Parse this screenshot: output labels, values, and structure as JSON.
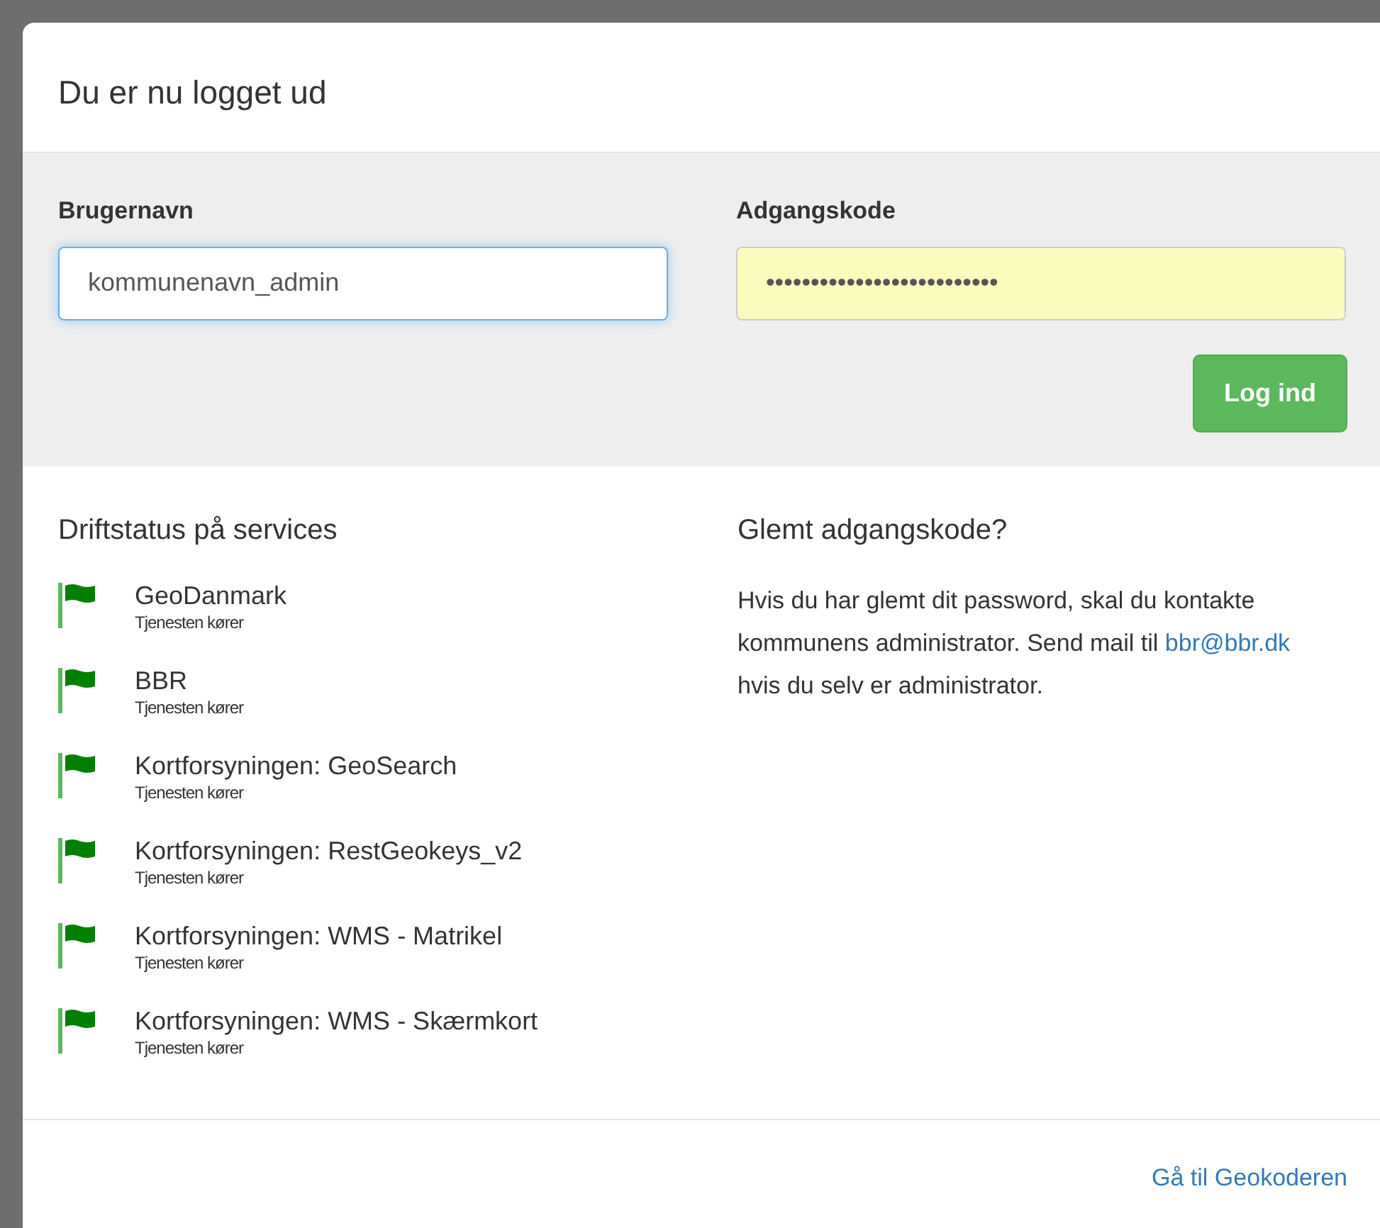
{
  "modal": {
    "title": "Du er nu logget ud"
  },
  "login": {
    "username": {
      "label": "Brugernavn",
      "value": "kommunenavn_admin",
      "focused": true
    },
    "password": {
      "label": "Adgangskode",
      "value": "••••••••••••••••••••••••••",
      "autofilled": true
    },
    "submit": "Log ind"
  },
  "services": {
    "heading": "Driftstatus på services",
    "items": [
      {
        "name": "GeoDanmark",
        "status_text": "Tjenesten kører",
        "color": "#008000"
      },
      {
        "name": "BBR",
        "status_text": "Tjenesten kører",
        "color": "#008000"
      },
      {
        "name": "Kortforsyningen: GeoSearch",
        "status_text": "Tjenesten kører",
        "color": "#008000"
      },
      {
        "name": "Kortforsyningen: RestGeokeys_v2",
        "status_text": "Tjenesten kører",
        "color": "#008000"
      },
      {
        "name": "Kortforsyningen: WMS - Matrikel",
        "status_text": "Tjenesten kører",
        "color": "#008000"
      },
      {
        "name": "Kortforsyningen: WMS - Skærmkort",
        "status_text": "Tjenesten kører",
        "color": "#008000"
      }
    ]
  },
  "forgot": {
    "heading": "Glemt adgangskode?",
    "text_before": "Hvis du har glemt dit password, skal du kontakte kommunens administrator. Send mail til ",
    "link": "bbr@bbr.dk",
    "text_after": " hvis du selv er administrator."
  },
  "footer": {
    "link": "Gå til Geokoderen"
  }
}
